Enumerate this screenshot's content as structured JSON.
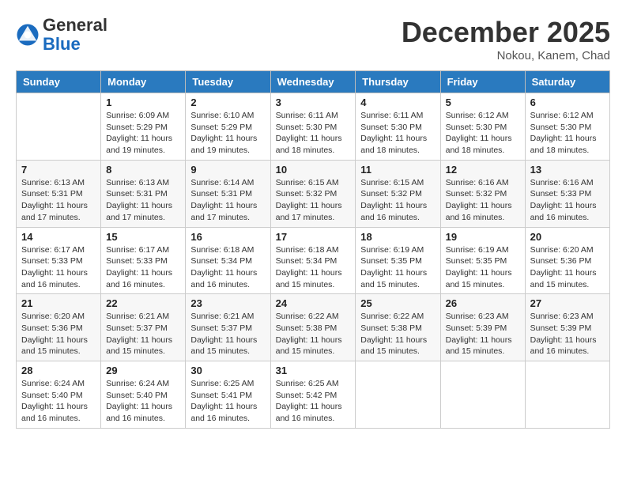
{
  "header": {
    "logo_general": "General",
    "logo_blue": "Blue",
    "month_title": "December 2025",
    "location": "Nokou, Kanem, Chad"
  },
  "columns": [
    "Sunday",
    "Monday",
    "Tuesday",
    "Wednesday",
    "Thursday",
    "Friday",
    "Saturday"
  ],
  "weeks": [
    [
      {
        "day": "",
        "info": ""
      },
      {
        "day": "1",
        "info": "Sunrise: 6:09 AM\nSunset: 5:29 PM\nDaylight: 11 hours\nand 19 minutes."
      },
      {
        "day": "2",
        "info": "Sunrise: 6:10 AM\nSunset: 5:29 PM\nDaylight: 11 hours\nand 19 minutes."
      },
      {
        "day": "3",
        "info": "Sunrise: 6:11 AM\nSunset: 5:30 PM\nDaylight: 11 hours\nand 18 minutes."
      },
      {
        "day": "4",
        "info": "Sunrise: 6:11 AM\nSunset: 5:30 PM\nDaylight: 11 hours\nand 18 minutes."
      },
      {
        "day": "5",
        "info": "Sunrise: 6:12 AM\nSunset: 5:30 PM\nDaylight: 11 hours\nand 18 minutes."
      },
      {
        "day": "6",
        "info": "Sunrise: 6:12 AM\nSunset: 5:30 PM\nDaylight: 11 hours\nand 18 minutes."
      }
    ],
    [
      {
        "day": "7",
        "info": "Sunrise: 6:13 AM\nSunset: 5:31 PM\nDaylight: 11 hours\nand 17 minutes."
      },
      {
        "day": "8",
        "info": "Sunrise: 6:13 AM\nSunset: 5:31 PM\nDaylight: 11 hours\nand 17 minutes."
      },
      {
        "day": "9",
        "info": "Sunrise: 6:14 AM\nSunset: 5:31 PM\nDaylight: 11 hours\nand 17 minutes."
      },
      {
        "day": "10",
        "info": "Sunrise: 6:15 AM\nSunset: 5:32 PM\nDaylight: 11 hours\nand 17 minutes."
      },
      {
        "day": "11",
        "info": "Sunrise: 6:15 AM\nSunset: 5:32 PM\nDaylight: 11 hours\nand 16 minutes."
      },
      {
        "day": "12",
        "info": "Sunrise: 6:16 AM\nSunset: 5:32 PM\nDaylight: 11 hours\nand 16 minutes."
      },
      {
        "day": "13",
        "info": "Sunrise: 6:16 AM\nSunset: 5:33 PM\nDaylight: 11 hours\nand 16 minutes."
      }
    ],
    [
      {
        "day": "14",
        "info": "Sunrise: 6:17 AM\nSunset: 5:33 PM\nDaylight: 11 hours\nand 16 minutes."
      },
      {
        "day": "15",
        "info": "Sunrise: 6:17 AM\nSunset: 5:33 PM\nDaylight: 11 hours\nand 16 minutes."
      },
      {
        "day": "16",
        "info": "Sunrise: 6:18 AM\nSunset: 5:34 PM\nDaylight: 11 hours\nand 16 minutes."
      },
      {
        "day": "17",
        "info": "Sunrise: 6:18 AM\nSunset: 5:34 PM\nDaylight: 11 hours\nand 15 minutes."
      },
      {
        "day": "18",
        "info": "Sunrise: 6:19 AM\nSunset: 5:35 PM\nDaylight: 11 hours\nand 15 minutes."
      },
      {
        "day": "19",
        "info": "Sunrise: 6:19 AM\nSunset: 5:35 PM\nDaylight: 11 hours\nand 15 minutes."
      },
      {
        "day": "20",
        "info": "Sunrise: 6:20 AM\nSunset: 5:36 PM\nDaylight: 11 hours\nand 15 minutes."
      }
    ],
    [
      {
        "day": "21",
        "info": "Sunrise: 6:20 AM\nSunset: 5:36 PM\nDaylight: 11 hours\nand 15 minutes."
      },
      {
        "day": "22",
        "info": "Sunrise: 6:21 AM\nSunset: 5:37 PM\nDaylight: 11 hours\nand 15 minutes."
      },
      {
        "day": "23",
        "info": "Sunrise: 6:21 AM\nSunset: 5:37 PM\nDaylight: 11 hours\nand 15 minutes."
      },
      {
        "day": "24",
        "info": "Sunrise: 6:22 AM\nSunset: 5:38 PM\nDaylight: 11 hours\nand 15 minutes."
      },
      {
        "day": "25",
        "info": "Sunrise: 6:22 AM\nSunset: 5:38 PM\nDaylight: 11 hours\nand 15 minutes."
      },
      {
        "day": "26",
        "info": "Sunrise: 6:23 AM\nSunset: 5:39 PM\nDaylight: 11 hours\nand 15 minutes."
      },
      {
        "day": "27",
        "info": "Sunrise: 6:23 AM\nSunset: 5:39 PM\nDaylight: 11 hours\nand 16 minutes."
      }
    ],
    [
      {
        "day": "28",
        "info": "Sunrise: 6:24 AM\nSunset: 5:40 PM\nDaylight: 11 hours\nand 16 minutes."
      },
      {
        "day": "29",
        "info": "Sunrise: 6:24 AM\nSunset: 5:40 PM\nDaylight: 11 hours\nand 16 minutes."
      },
      {
        "day": "30",
        "info": "Sunrise: 6:25 AM\nSunset: 5:41 PM\nDaylight: 11 hours\nand 16 minutes."
      },
      {
        "day": "31",
        "info": "Sunrise: 6:25 AM\nSunset: 5:42 PM\nDaylight: 11 hours\nand 16 minutes."
      },
      {
        "day": "",
        "info": ""
      },
      {
        "day": "",
        "info": ""
      },
      {
        "day": "",
        "info": ""
      }
    ]
  ]
}
